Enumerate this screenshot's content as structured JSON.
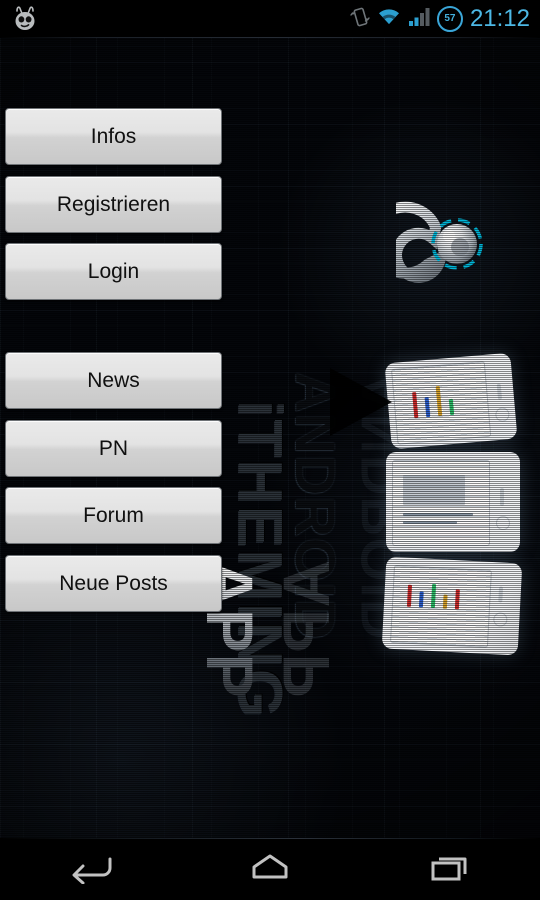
{
  "status_bar": {
    "logo_icon": "cyanogenmod-cid-icon",
    "icons": [
      {
        "name": "vibrate-icon",
        "label": "Vibrate"
      },
      {
        "name": "wifi-icon",
        "label": "Wi-Fi"
      },
      {
        "name": "signal-icon",
        "label": "Signal"
      }
    ],
    "battery": {
      "name": "battery-icon",
      "percent": "57"
    },
    "clock": "21:12",
    "clock_color": "#4db8e5"
  },
  "menu": {
    "group_primary": [
      {
        "id": "infos",
        "label": "Infos"
      },
      {
        "id": "registrieren",
        "label": "Registrieren"
      },
      {
        "id": "login",
        "label": "Login"
      }
    ],
    "group_secondary": [
      {
        "id": "news",
        "label": "News"
      },
      {
        "id": "pn",
        "label": "PN"
      },
      {
        "id": "forum",
        "label": "Forum"
      },
      {
        "id": "neue-posts",
        "label": "Neue Posts"
      }
    ]
  },
  "artwork": {
    "brand_vertical": "iTHEMING",
    "platform_vertical": "ANDROID",
    "app_vertical": "APP",
    "ring_logo_name": "itheming-ring-logo",
    "accent_color": "#00bcd4",
    "phone_mockups": 3
  },
  "nav_bar": {
    "buttons": [
      {
        "id": "back",
        "name": "nav-back-icon",
        "label": "Back"
      },
      {
        "id": "home",
        "name": "nav-home-icon",
        "label": "Home"
      },
      {
        "id": "recents",
        "name": "nav-recents-icon",
        "label": "Recent apps"
      }
    ]
  }
}
